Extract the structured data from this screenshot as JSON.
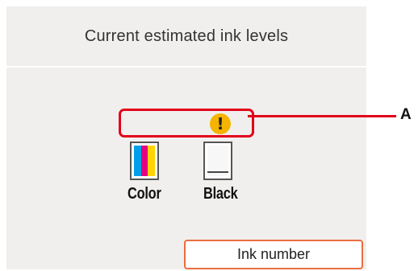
{
  "header": {
    "title": "Current estimated ink levels"
  },
  "ink_levels": [
    {
      "label": "Color",
      "icon": "color-ink-icon",
      "level": 1.0,
      "bar_colors": [
        "#00a0e9",
        "#e4007f",
        "#ffd400"
      ]
    },
    {
      "label": "Black",
      "icon": "black-ink-icon",
      "level": 0.05
    }
  ],
  "warning": {
    "icon": "warning-icon",
    "glyph": "!",
    "color": "#f4b400"
  },
  "buttons": {
    "ink_number": "Ink number"
  },
  "annotation": {
    "label": "A",
    "color": "#e2001a"
  }
}
